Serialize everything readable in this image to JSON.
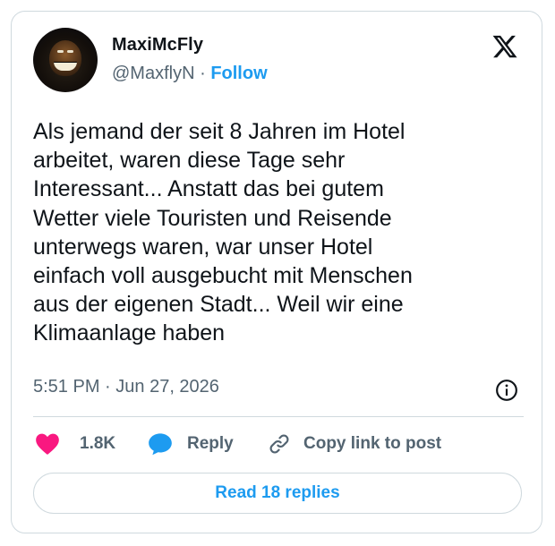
{
  "author": {
    "name": "MaxiMcFly",
    "handle": "@MaxflyN",
    "separator": " · ",
    "follow_label": "Follow",
    "avatar_icon": "avatar-image"
  },
  "platform_icon": "x-logo-icon",
  "tweet": {
    "lines": [
      "Als jemand der seit 8 Jahren im Hotel",
      "arbeitet, waren diese Tage sehr",
      "Interessant... Anstatt das bei gutem",
      "Wetter viele Touristen und Reisende",
      "unterwegs waren, war unser Hotel",
      "einfach voll ausgebucht mit Menschen",
      "aus der eigenen Stadt... Weil wir eine",
      "Klimaanlage haben"
    ],
    "time": "5:51 PM",
    "time_separator": " · ",
    "date": "Jun 27, 2026"
  },
  "actions": {
    "likes_count": "1.8K",
    "reply_label": "Reply",
    "copy_label": "Copy link to post"
  },
  "read_replies_label": "Read 18 replies",
  "colors": {
    "accent": "#1d9bf0",
    "heart": "#f91880",
    "secondary_text": "#536471",
    "border": "#cfd9de"
  }
}
